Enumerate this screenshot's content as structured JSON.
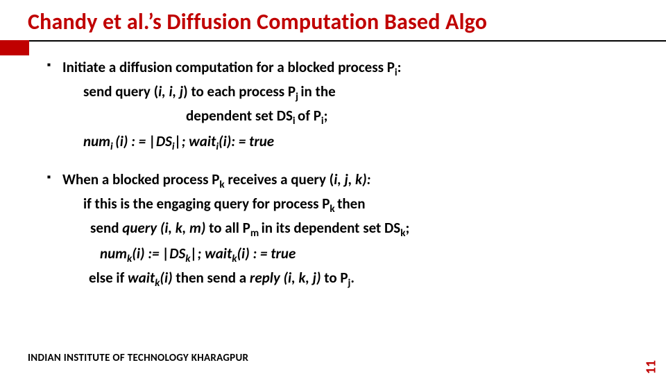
{
  "title": "Chandy et al.’s Diffusion Computation Based Algo",
  "bullet1": {
    "head_pre": "Initiate a diffusion computation for a blocked process P",
    "head_sub": "i",
    "head_post": ":",
    "l1_a": "send query (",
    "l1_b": "i, i, j",
    "l1_c": ") to each process P",
    "l1_sub": "j ",
    "l1_d": "in the",
    "l2_a": "dependent set DS",
    "l2_sub": "i ",
    "l2_b": "of P",
    "l2_sub2": "i",
    "l2_c": ";",
    "l3_a": "num",
    "l3_s1": "i ",
    "l3_b": "(i) : = |DS",
    "l3_s2": "i",
    "l3_c": "|; wait",
    "l3_s3": "i",
    "l3_d": "(i): = true"
  },
  "bullet2": {
    "head_a": "When a blocked process P",
    "head_s1": "k",
    "head_b": " receives a query (",
    "head_c": "i, j, k):",
    "l1_a": "if this is the engaging query for process P",
    "l1_s": "k ",
    "l1_b": "then",
    "l2_a": "send ",
    "l2_b": "query (i, k, m) ",
    "l2_c": "to all P",
    "l2_s": "m ",
    "l2_d": "in its dependent set DS",
    "l2_s2": "k",
    "l2_e": ";",
    "l3_a": "num",
    "l3_s1": "k",
    "l3_b": "(i) := |DS",
    "l3_s2": "k",
    "l3_c": "|; wait",
    "l3_s3": "k",
    "l3_d": "(i) : = true",
    "l4_a": "else if ",
    "l4_b": "wait",
    "l4_s1": "k",
    "l4_c": "(i) ",
    "l4_d": "then send a ",
    "l4_e": "reply (i, k, j) ",
    "l4_f": "to P",
    "l4_s2": "j",
    "l4_g": "."
  },
  "footer": "INDIAN INSTITUTE OF TECHNOLOGY KHARAGPUR",
  "page": "11"
}
